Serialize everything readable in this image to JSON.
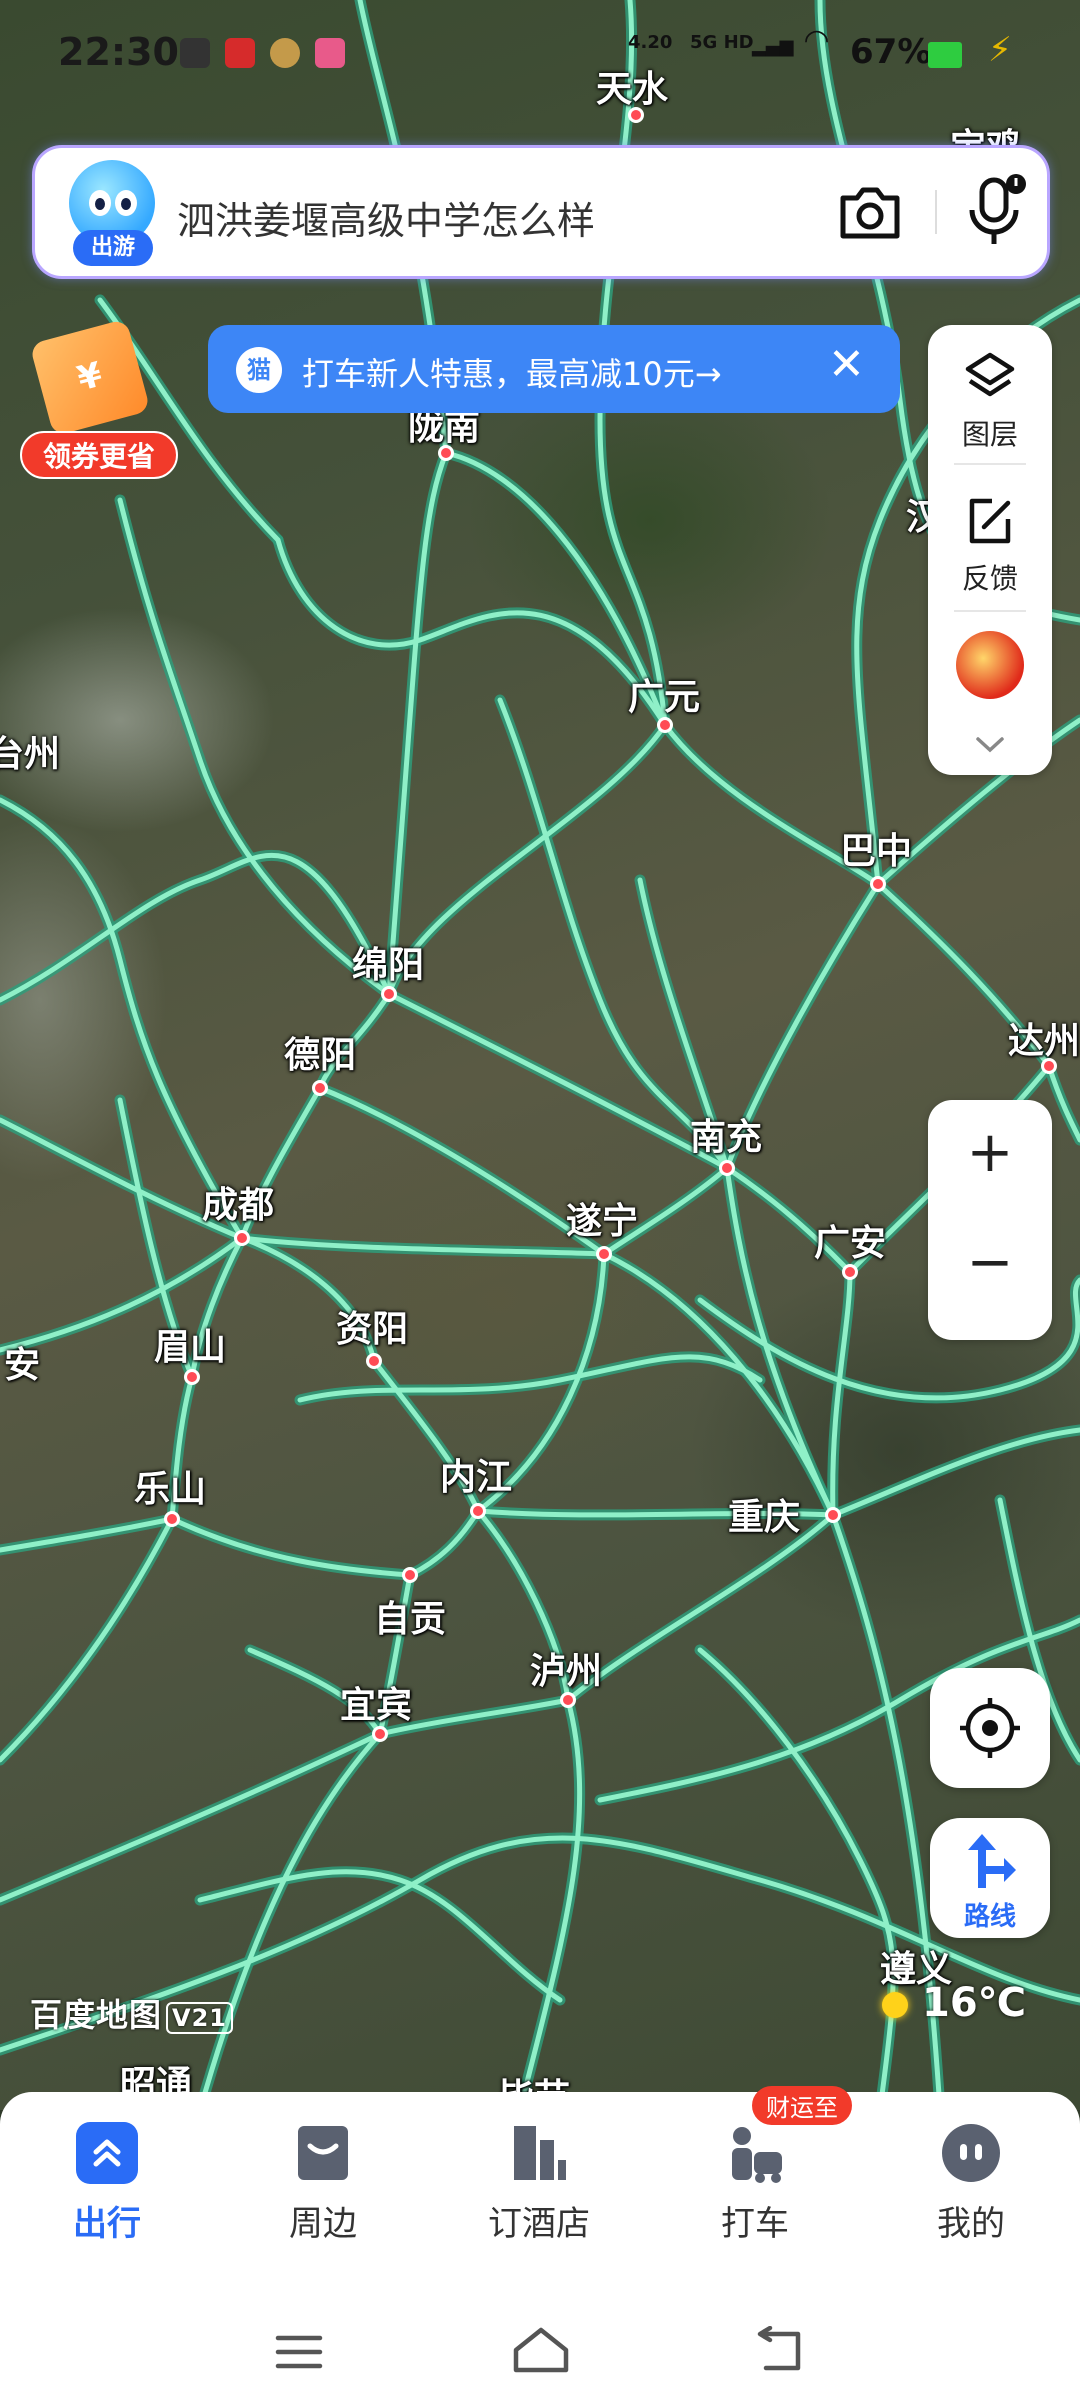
{
  "status_bar": {
    "time": "22:30",
    "battery": "67%",
    "network_speed": "4.20",
    "network_type": "5G HD"
  },
  "search": {
    "avatar_tag": "出游",
    "placeholder": "泗洪姜堰高级中学怎么样"
  },
  "coupon": {
    "label": "领券更省",
    "ticket_symbol": "¥"
  },
  "promo": {
    "icon": "猫",
    "text": "打车新人特惠，最高减10元→",
    "close": "✕"
  },
  "tools": {
    "layers_label": "图层",
    "feedback_label": "反馈"
  },
  "zoom": {
    "in": "+",
    "out": "−"
  },
  "route": {
    "label": "路线"
  },
  "map": {
    "logo": "百度地图",
    "logo_version": "V21",
    "weather_temp": "16℃",
    "cities": [
      {
        "name": "天水",
        "dot": true
      },
      {
        "name": "宝鸡",
        "dot": false
      },
      {
        "name": "陇南",
        "dot": true
      },
      {
        "name": "汉",
        "dot": false
      },
      {
        "name": "广元",
        "dot": true
      },
      {
        "name": "台州",
        "dot": false
      },
      {
        "name": "巴中",
        "dot": true
      },
      {
        "name": "绵阳",
        "dot": true
      },
      {
        "name": "达州",
        "dot": true
      },
      {
        "name": "德阳",
        "dot": true
      },
      {
        "name": "南充",
        "dot": true
      },
      {
        "name": "成都",
        "dot": true
      },
      {
        "name": "遂宁",
        "dot": true
      },
      {
        "name": "广安",
        "dot": true
      },
      {
        "name": "安",
        "dot": false
      },
      {
        "name": "眉山",
        "dot": true
      },
      {
        "name": "资阳",
        "dot": true
      },
      {
        "name": "内江",
        "dot": true
      },
      {
        "name": "乐山",
        "dot": true
      },
      {
        "name": "重庆",
        "dot": true
      },
      {
        "name": "自贡",
        "dot": true
      },
      {
        "name": "泸州",
        "dot": true
      },
      {
        "name": "宜宾",
        "dot": true
      },
      {
        "name": "遵义",
        "dot": false
      },
      {
        "name": "昭通",
        "dot": false
      },
      {
        "name": "毕节",
        "dot": false
      }
    ]
  },
  "bottom_nav": {
    "items": [
      {
        "label": "出行",
        "active": true
      },
      {
        "label": "周边",
        "active": false
      },
      {
        "label": "订酒店",
        "active": false
      },
      {
        "label": "打车",
        "active": false
      },
      {
        "label": "我的",
        "active": false
      }
    ],
    "badge": "财运至"
  },
  "colors": {
    "road": "#8ff0c8",
    "road_outline": "#2f9c7a",
    "accent": "#2a6cf6",
    "city_dot": "#ff4b55"
  }
}
